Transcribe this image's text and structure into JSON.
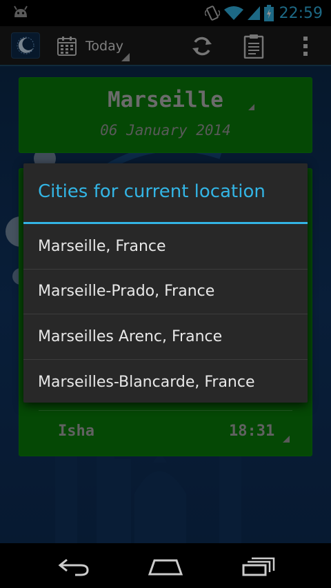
{
  "status_bar": {
    "time": "22:59",
    "icons": [
      "android-debug-icon",
      "vibrate-icon",
      "wifi-icon",
      "signal-icon",
      "battery-charging-icon"
    ]
  },
  "action_bar": {
    "app_icon": "crescent-logo-icon",
    "date_spinner_label": "Today",
    "actions": [
      "refresh-icon",
      "clipboard-icon",
      "overflow-menu-icon"
    ]
  },
  "location_panel": {
    "city": "Marseille",
    "date": "06 January 2014"
  },
  "prayer_panel": {
    "visible_row": {
      "name": "Isha",
      "time": "18:31"
    }
  },
  "dialog": {
    "title": "Cities for current location",
    "items": [
      "Marseille, France",
      "Marseille-Prado, France",
      "Marseilles Arenc, France",
      "Marseilles-Blancarde, France"
    ]
  },
  "nav_bar": {
    "buttons": [
      "back-icon",
      "home-icon",
      "recent-apps-icon"
    ]
  },
  "colors": {
    "accent": "#33b5e5",
    "panel_green": "#0a7d0a",
    "dialog_bg": "#282828"
  }
}
